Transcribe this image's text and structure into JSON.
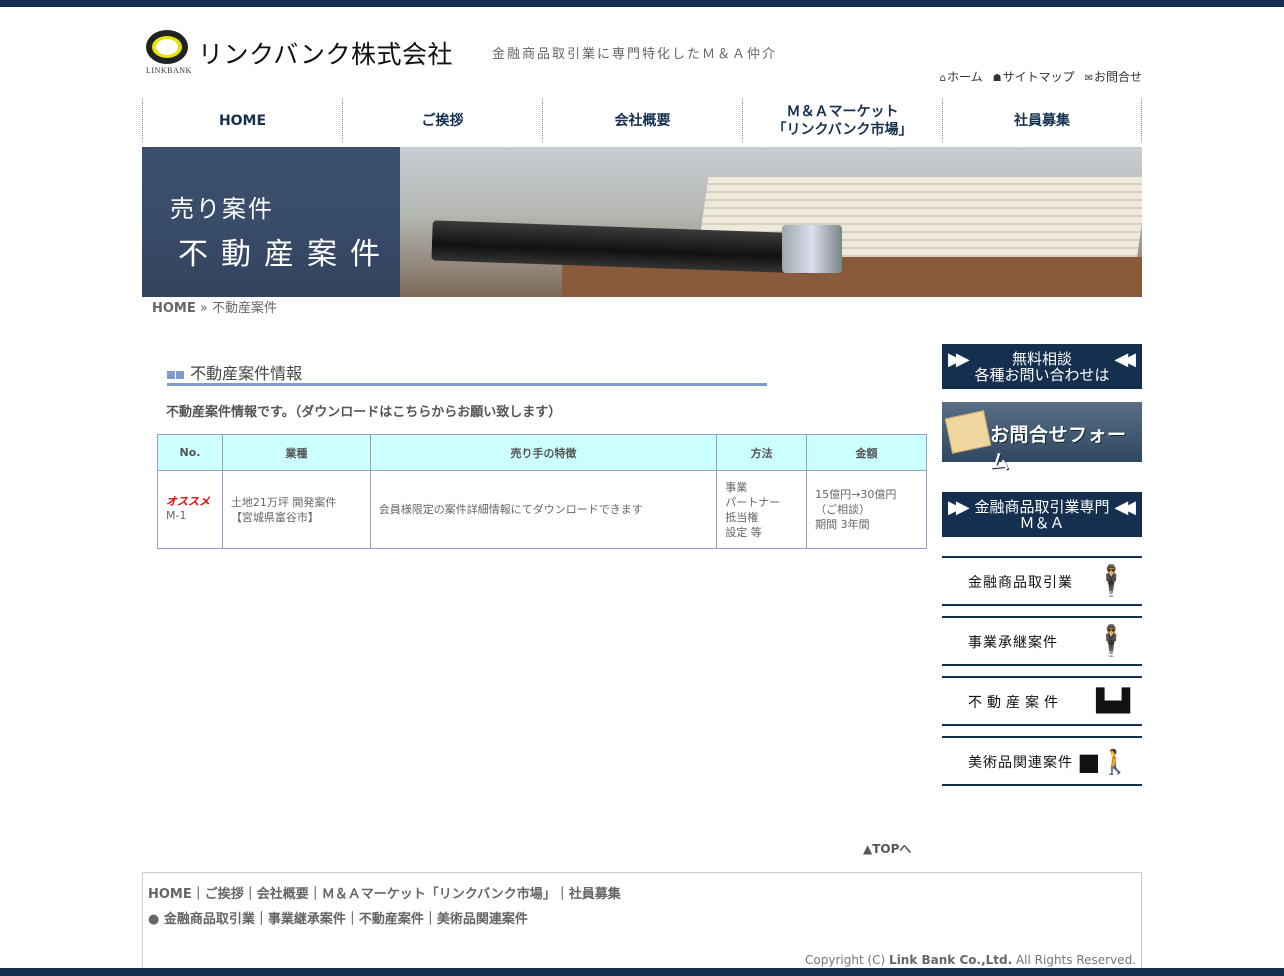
{
  "header": {
    "logo_text": "LINKBANK",
    "company": "リンクバンク株式会社",
    "tagline": "金融商品取引業に専門特化したＭ＆Ａ仲介",
    "util": [
      {
        "icon": "home-icon",
        "label": "ホーム"
      },
      {
        "icon": "sitemap-icon",
        "label": "サイトマップ"
      },
      {
        "icon": "mail-icon",
        "label": "お問合せ"
      }
    ]
  },
  "nav": [
    "HOME",
    "ご挨拶",
    "会社概要",
    "Ｍ＆Ａマーケット\n「リンクバンク市場」",
    "社員募集"
  ],
  "banner": {
    "line1": "売り案件",
    "line2": "不動産案件"
  },
  "breadcrumb": {
    "home": "HOME",
    "sep": "»",
    "current": "不動産案件"
  },
  "main": {
    "section_title": "不動産案件情報",
    "intro": "不動産案件情報です。（ダウンロードはこちらからお願い致します）",
    "table": {
      "headers": [
        "No.",
        "業種",
        "売り手の特徴",
        "方法",
        "金額"
      ],
      "rows": [
        {
          "badge": "オススメ",
          "no": "M-1",
          "industry_1": "土地21万坪 開発案件",
          "industry_2": "【宮城県富谷市】",
          "feature": "会員様限定の案件詳細情報にてダウンロードできます",
          "method_1": "事業",
          "method_2": "パートナー",
          "method_3": "抵当権",
          "method_4": "設定 等",
          "amount_1": "15億円→30億円",
          "amount_2": "（ご相談）",
          "amount_3": "期間 3年間"
        }
      ]
    },
    "to_top": "▲TOPへ"
  },
  "sidebar": {
    "consult": "無料相談\n各種お問い合わせは",
    "form": "お問合せフォーム",
    "specialty": "金融商品取引業専門\nＭ＆Ａ",
    "items": [
      {
        "label": "金融商品取引業",
        "icon": "person-pointing-icon"
      },
      {
        "label": "事業承継案件",
        "icon": "person-presenting-icon"
      },
      {
        "label": "不動産案件",
        "icon": "people-at-desk-icon"
      },
      {
        "label": "美術品関連案件",
        "icon": "person-carrying-icon"
      }
    ]
  },
  "footer": {
    "line1": "HOME｜ご挨拶｜会社概要｜Ｍ＆Ａマーケット「リンクバンク市場」｜社員募集",
    "line2": "●  金融商品取引業｜事業継承案件｜不動産案件｜美術品関連案件",
    "copy_prefix": "Copyright (C) ",
    "copy_name": "Link Bank Co.,Ltd.",
    "copy_suffix": " All Rights Reserved."
  }
}
